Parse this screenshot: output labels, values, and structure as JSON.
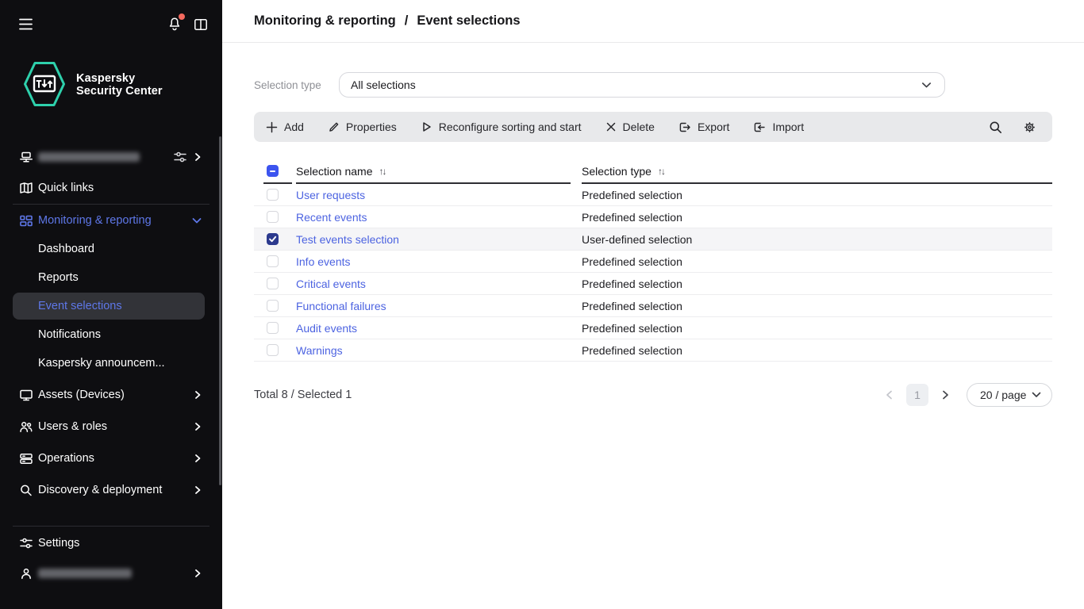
{
  "colors": {
    "sidebar_bg": "#0e0e11",
    "accent_blue": "#5e77e8",
    "link_blue": "#4c63e1",
    "brand_teal": "#2ed0ac",
    "alert_red": "#f4695e",
    "checkbox_checked": "#2c3a8e",
    "checkbox_indeterminate": "#3c54ef",
    "toolbar_bg": "#e8e9eb",
    "active_item_bg": "#323338"
  },
  "logo": {
    "line1": "Kaspersky",
    "line2": "Security Center"
  },
  "sidebar": {
    "quick_links": "Quick links",
    "monitoring": "Monitoring & reporting",
    "monitoring_children": [
      "Dashboard",
      "Reports",
      "Event selections",
      "Notifications",
      "Kaspersky announcem..."
    ],
    "assets": "Assets (Devices)",
    "users_roles": "Users & roles",
    "operations": "Operations",
    "discovery": "Discovery & deployment",
    "settings": "Settings",
    "active_item": "Event selections"
  },
  "breadcrumb": {
    "parent": "Monitoring & reporting",
    "separator": "/",
    "current": "Event selections"
  },
  "filter": {
    "label": "Selection type",
    "value": "All selections"
  },
  "toolbar": {
    "buttons": [
      "Add",
      "Properties",
      "Reconfigure sorting and start",
      "Delete",
      "Export",
      "Import"
    ]
  },
  "icons": {
    "sort": "↑↓"
  },
  "table": {
    "columns": [
      "Selection name",
      "Selection type"
    ],
    "header_checkbox_state": "indeterminate",
    "rows": [
      {
        "name": "User requests",
        "type": "Predefined selection",
        "checked": false
      },
      {
        "name": "Recent events",
        "type": "Predefined selection",
        "checked": false
      },
      {
        "name": "Test events selection",
        "type": "User-defined selection",
        "checked": true
      },
      {
        "name": "Info events",
        "type": "Predefined selection",
        "checked": false
      },
      {
        "name": "Critical events",
        "type": "Predefined selection",
        "checked": false
      },
      {
        "name": "Functional failures",
        "type": "Predefined selection",
        "checked": false
      },
      {
        "name": "Audit events",
        "type": "Predefined selection",
        "checked": false
      },
      {
        "name": "Warnings",
        "type": "Predefined selection",
        "checked": false
      }
    ]
  },
  "footer": {
    "summary": "Total 8 / Selected 1",
    "current_page": "1",
    "page_size": "20 / page"
  }
}
